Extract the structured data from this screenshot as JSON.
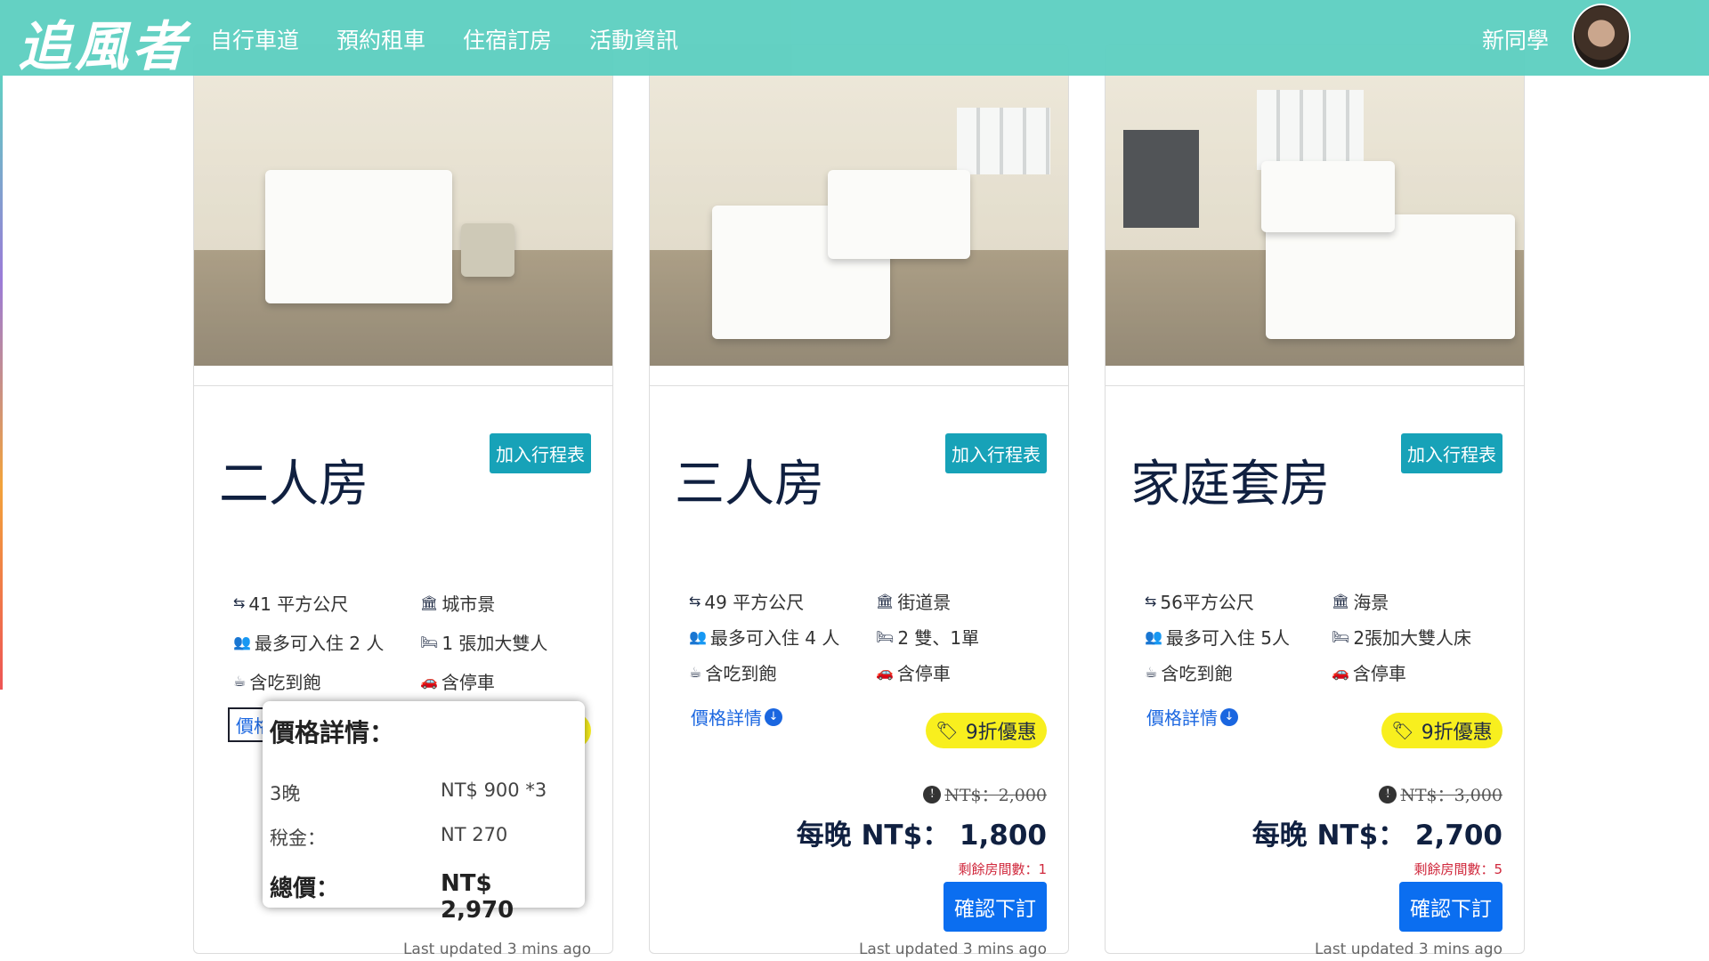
{
  "navbar": {
    "brand": "追風者",
    "links": [
      "自行車道",
      "預約租車",
      "住宿訂房",
      "活動資訊"
    ],
    "user_name": "新同學"
  },
  "add_label": "加入行程表",
  "price_details_label": "價格詳情",
  "discount_label": "9折優惠",
  "confirm_label": "確認下訂",
  "updated_text": "Last updated 3 mins ago",
  "rooms": [
    {
      "title": "二人房",
      "size": "41 平方公尺",
      "view": "城市景",
      "capacity": "最多可入住 2 人",
      "bed": "1 張加大雙人",
      "meal": "含吃到飽",
      "parking": "含停車"
    },
    {
      "title": "三人房",
      "size": "49 平方公尺",
      "view": "街道景",
      "capacity": "最多可入住 4 人",
      "bed": "2 雙、1單",
      "meal": "含吃到飽",
      "parking": "含停車",
      "old_price": "NT$：2,000",
      "night_price": "每晚 NT$： 1,800",
      "remaining": "剩餘房間數：1"
    },
    {
      "title": "家庭套房",
      "size": "56平方公尺",
      "view": "海景",
      "capacity": "最多可入住 5人",
      "bed": "2張加大雙人床",
      "meal": "含吃到飽",
      "parking": "含停車",
      "old_price": "NT$：3,000",
      "night_price": "每晚 NT$： 2,700",
      "remaining": "剩餘房間數：5"
    }
  ],
  "popover": {
    "title": "價格詳情：",
    "nights_label": "3晚",
    "nights_value": "NT$ 900 *3",
    "tax_label": "稅金：",
    "tax_value": "NT 270",
    "total_label": "總價：",
    "total_value": "NT$ 2,970"
  },
  "icons": [
    "area-icon",
    "bank-icon",
    "users-icon",
    "bed-icon",
    "coffee-icon",
    "car-icon",
    "tag-icon",
    "arrow-circle-down-icon",
    "info-icon"
  ]
}
